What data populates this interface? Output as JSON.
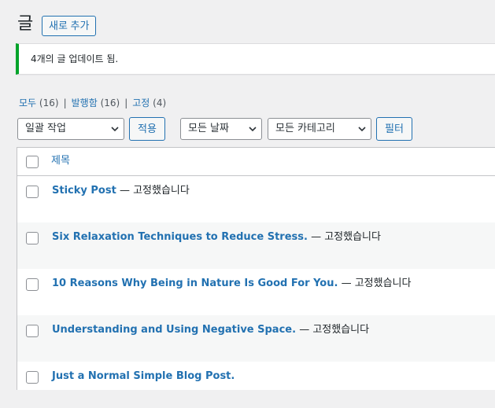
{
  "header": {
    "title": "글",
    "add_new_label": "새로 추가"
  },
  "notice": {
    "text": "4개의 글 업데이트 됨."
  },
  "filters": {
    "all_label": "모두",
    "all_count": "(16)",
    "published_label": "발행함",
    "published_count": "(16)",
    "sticky_label": "고정",
    "sticky_count": "(4)",
    "separator": "|"
  },
  "tablenav": {
    "bulk_action_selected": "일괄 작업",
    "apply_label": "적용",
    "dates_selected": "모든 날짜",
    "categories_selected": "모든 카테고리",
    "filter_label": "필터"
  },
  "table": {
    "header_title": "제목",
    "rows": [
      {
        "title": "Sticky Post",
        "state": "— 고정했습니다"
      },
      {
        "title": "Six Relaxation Techniques to Reduce Stress.",
        "state": "— 고정했습니다"
      },
      {
        "title": "10 Reasons Why Being in Nature Is Good For You.",
        "state": "— 고정했습니다"
      },
      {
        "title": "Understanding and Using Negative Space.",
        "state": "— 고정했습니다"
      },
      {
        "title": "Just a Normal Simple Blog Post.",
        "state": ""
      }
    ]
  },
  "colors": {
    "accent": "#2271b1",
    "success_border": "#00a32a",
    "background": "#f0f0f1"
  },
  "icons": {
    "dropdown": "chevron-down-icon"
  }
}
